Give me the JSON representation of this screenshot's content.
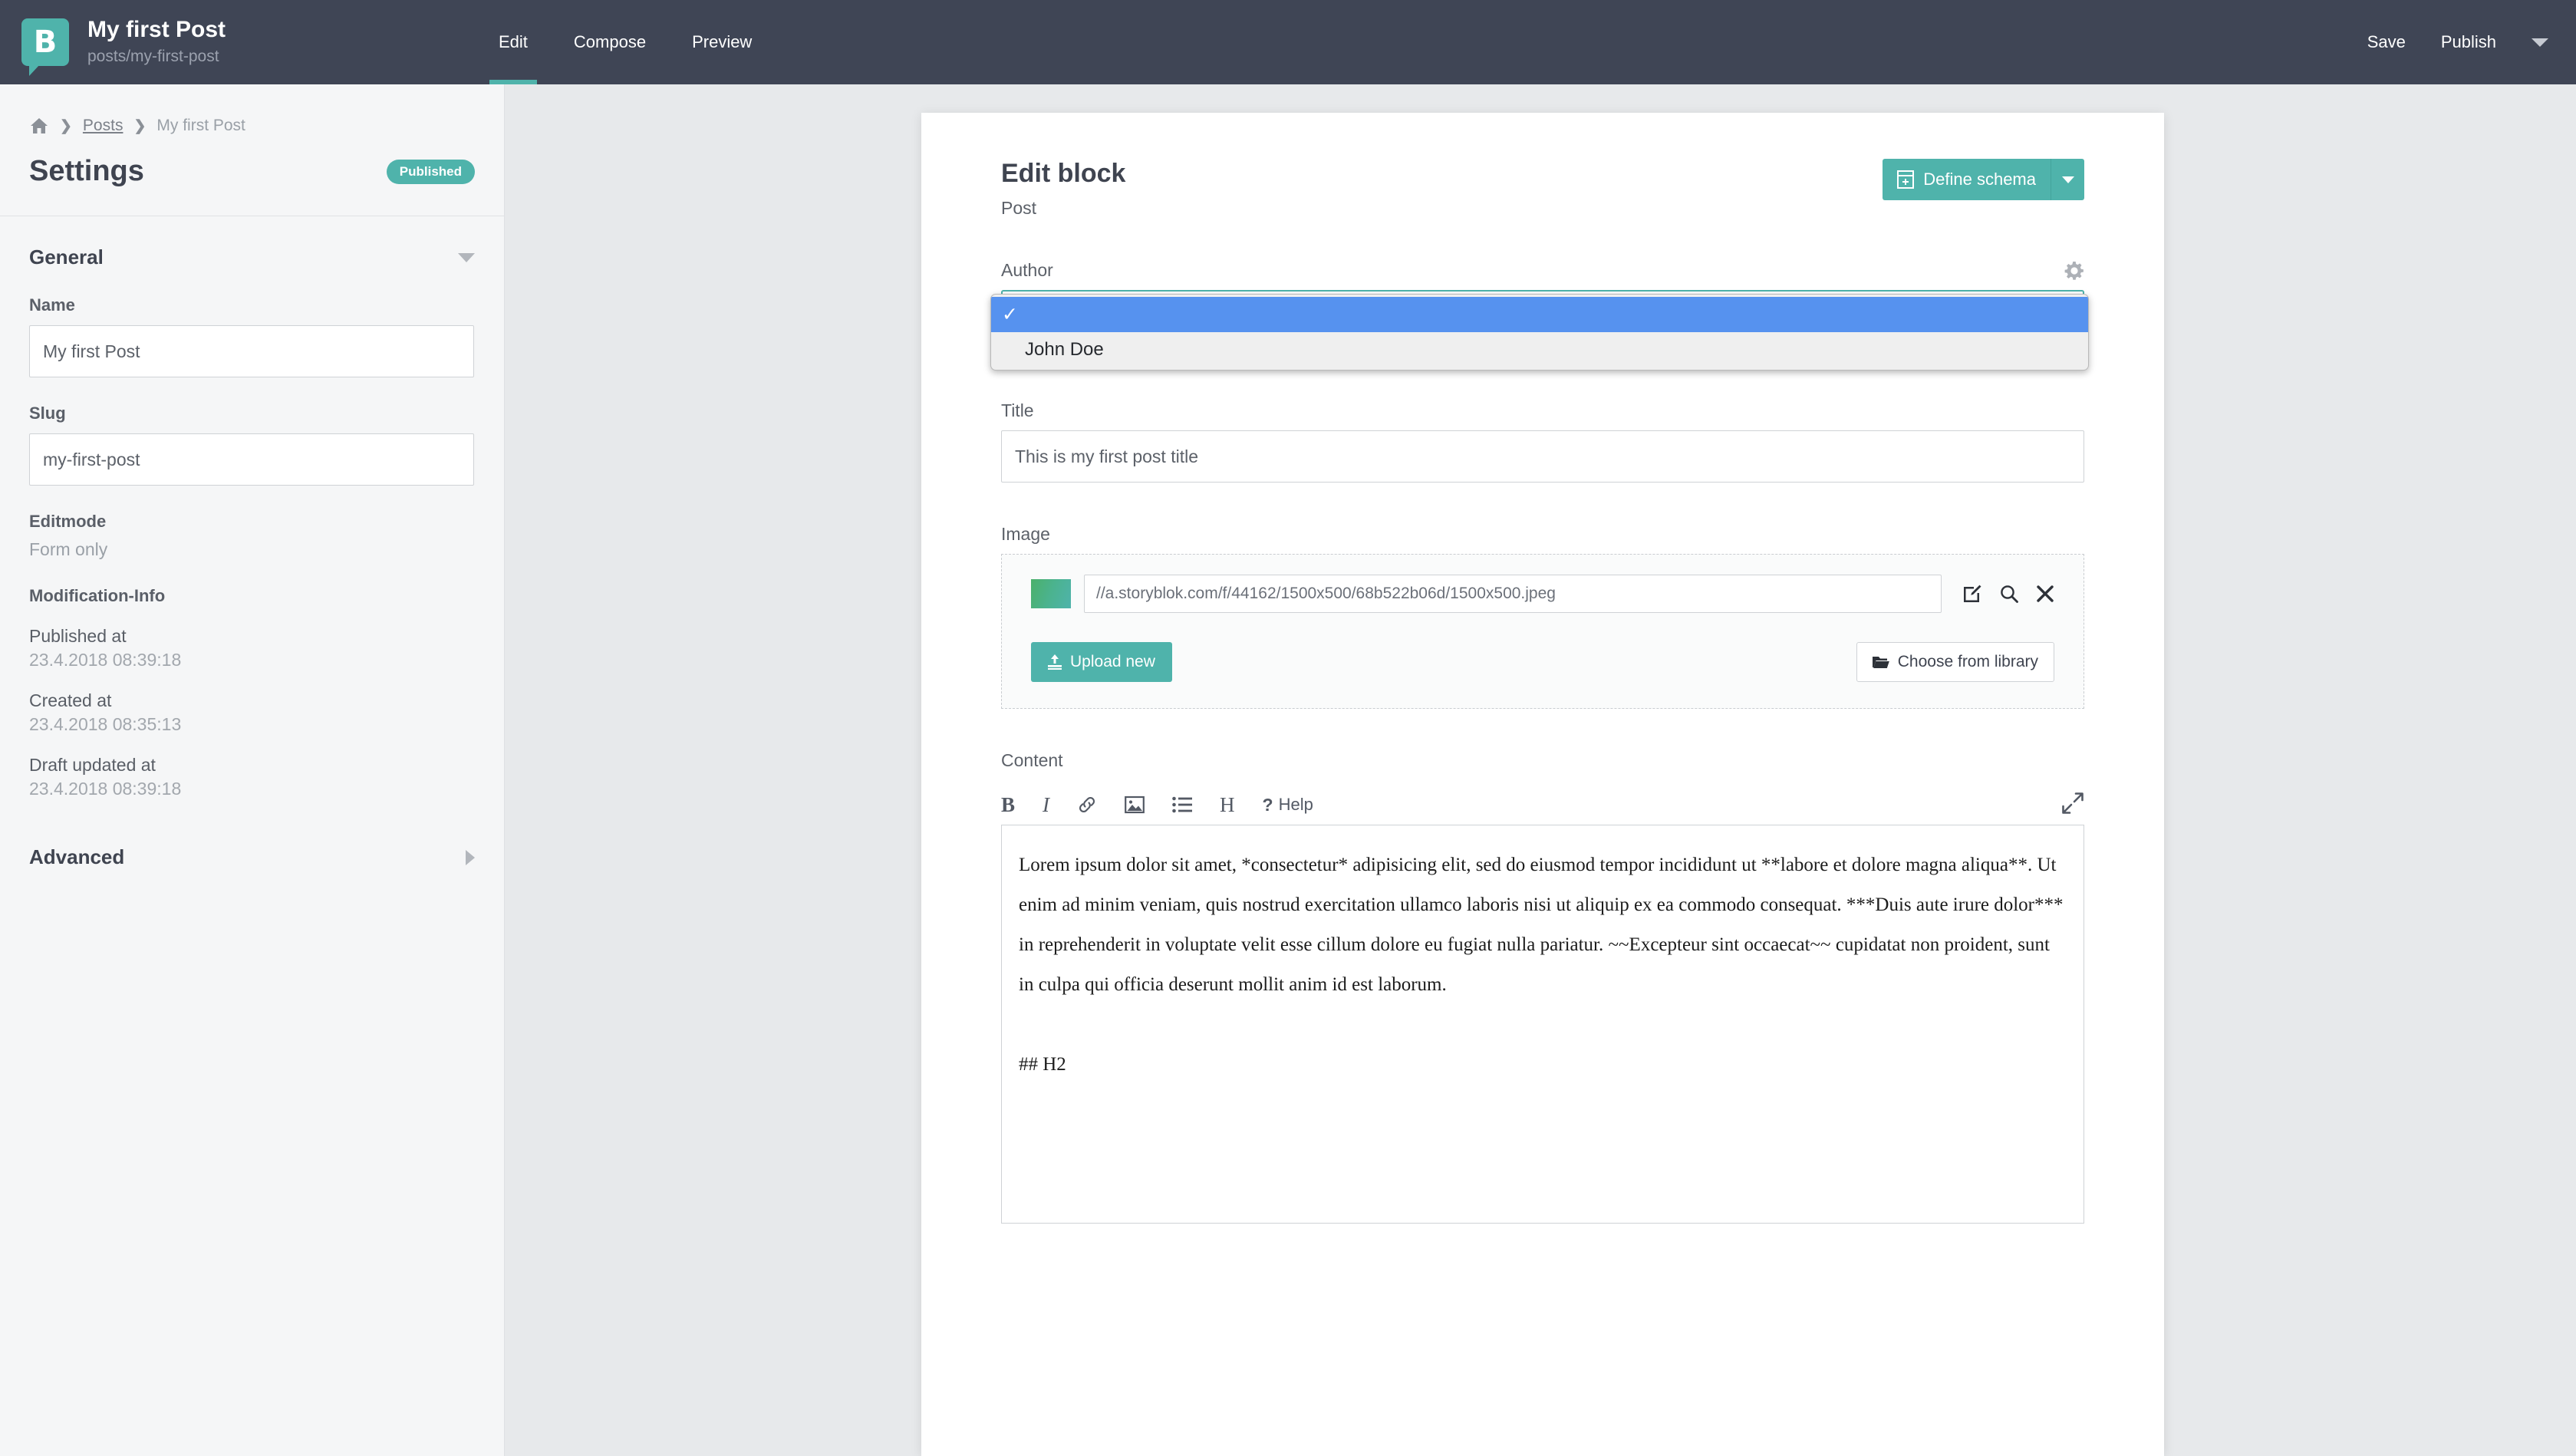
{
  "topbar": {
    "logo_letter": "B",
    "title": "My first Post",
    "subtitle": "posts/my-first-post",
    "tabs": [
      {
        "label": "Edit",
        "active": true
      },
      {
        "label": "Compose",
        "active": false
      },
      {
        "label": "Preview",
        "active": false
      }
    ],
    "save_label": "Save",
    "publish_label": "Publish"
  },
  "sidebar": {
    "breadcrumb": {
      "sep": "❯",
      "posts": "Posts",
      "current": "My first Post"
    },
    "settings_title": "Settings",
    "status_badge": "Published",
    "general_section": "General",
    "advanced_section": "Advanced",
    "name_label": "Name",
    "name_value": "My first Post",
    "slug_label": "Slug",
    "slug_value": "my-first-post",
    "editmode_label": "Editmode",
    "editmode_value": "Form only",
    "modinfo_label": "Modification-Info",
    "published_at_label": "Published at",
    "published_at_value": "23.4.2018 08:39:18",
    "created_at_label": "Created at",
    "created_at_value": "23.4.2018 08:35:13",
    "draft_updated_label": "Draft updated at",
    "draft_updated_value": "23.4.2018 08:39:18"
  },
  "main": {
    "card_title": "Edit block",
    "card_subtitle": "Post",
    "define_schema_label": "Define schema",
    "author": {
      "label": "Author",
      "selected_value": "",
      "options": [
        {
          "label": "",
          "selected": true
        },
        {
          "label": "John Doe",
          "selected": false
        }
      ],
      "check_glyph": "✓"
    },
    "title_field": {
      "label": "Title",
      "value": "This is my first post title"
    },
    "image_field": {
      "label": "Image",
      "url": "//a.storyblok.com/f/44162/1500x500/68b522b06d/1500x500.jpeg",
      "upload_label": "Upload new",
      "library_label": "Choose from library"
    },
    "content_field": {
      "label": "Content",
      "help_label": "Help",
      "help_glyph": "?",
      "bold_glyph": "B",
      "italic_glyph": "I",
      "heading_glyph": "H",
      "value": "Lorem ipsum dolor sit amet, *consectetur* adipisicing elit, sed do eiusmod tempor incididunt ut **labore et dolore magna aliqua**. Ut enim ad minim veniam, quis nostrud exercitation ullamco laboris nisi ut aliquip ex ea commodo consequat. ***Duis aute irure dolor*** in reprehenderit in voluptate velit esse cillum dolore eu fugiat nulla pariatur. ~~Excepteur sint occaecat~~ cupidatat non proident, sunt in culpa qui officia deserunt mollit anim id est laborum.\n\n## H2"
    }
  },
  "colors": {
    "accent_teal": "#4fb3ab",
    "topbar_dark": "#3f4555",
    "page_bg": "#e7e9eb",
    "select_highlight": "#5692ef"
  }
}
